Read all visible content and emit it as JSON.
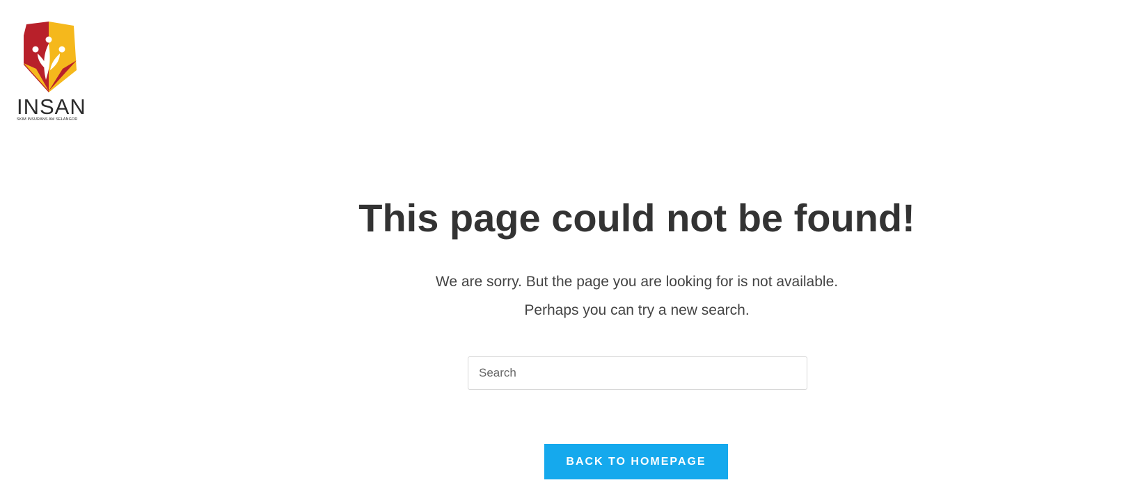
{
  "logo": {
    "name": "INSAN",
    "tagline": "SKIM INSURANS AM SELANGOR",
    "colors": {
      "red": "#b8202a",
      "yellow": "#f5b81c"
    }
  },
  "heading": "This page could not be found!",
  "message": {
    "line1": "We are sorry. But the page you are looking for is not available.",
    "line2": "Perhaps you can try a new search."
  },
  "search": {
    "placeholder": "Search",
    "value": ""
  },
  "back_button": {
    "label": "BACK TO HOMEPAGE",
    "color": "#15a9ed"
  }
}
